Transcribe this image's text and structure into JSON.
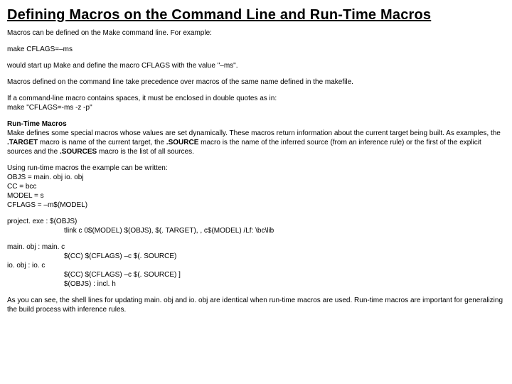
{
  "title": "Defining Macros on the Command Line and Run-Time Macros",
  "p1": "Macros can be defined on the Make command line. For example:",
  "code1": "make CFLAGS=–ms",
  "p2": "would start up Make and define the macro CFLAGS with the value \"–ms\".",
  "p3": "Macros defined on the command line take precedence over macros of the same name defined in the makefile.",
  "p4a": "If a command-line macro contains spaces, it must be enclosed in double quotes as in:",
  "p4b": "make \"CFLAGS=-ms -z -p\"",
  "subheading": "Run-Time Macros",
  "p5a": "Make defines some special macros whose values are set dynamically. These macros return information about the current target being built. As examples, the ",
  "p5_target": ".TARGET",
  "p5b": " macro is name of the current target, the ",
  "p5_source": ".SOURCE",
  "p5c": " macro is the name of the inferred source (from an inference rule) or the first of the explicit sources and the ",
  "p5_sources": ".SOURCES",
  "p5d": " macro is the list of all sources.",
  "p6a": "Using run-time macros the example can be written:",
  "code_block1": [
    "OBJS = main. obj io. obj",
    "CC = bcc",
    "MODEL = s",
    "CFLAGS = –m$(MODEL)"
  ],
  "code_block2": [
    "project. exe : $(OBJS)",
    "tlink c 0$(MODEL) $(OBJS), $(. TARGET), , c$(MODEL) /Lf: \\bc\\lib"
  ],
  "code_block3": [
    "main. obj : main. c",
    "$(CC) $(CFLAGS) –c $(. SOURCE)",
    "io. obj : io. c",
    "$(CC) $(CFLAGS) –c $(. SOURCE) ]",
    "$(OBJS) : incl. h"
  ],
  "code_block3_indent": [
    false,
    true,
    false,
    true,
    true
  ],
  "p7": "As you can see, the shell lines for updating main. obj and io. obj are identical when run-time macros are used. Run-time macros are important for generalizing the build process with inference rules."
}
